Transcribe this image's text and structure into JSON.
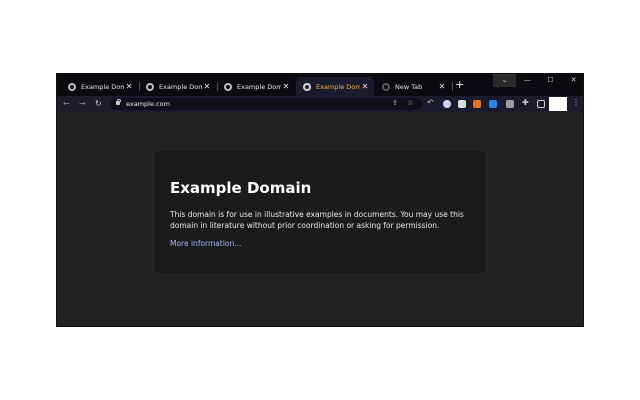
{
  "tabs": [
    {
      "label": "Example Domain",
      "close": "✕",
      "active": false
    },
    {
      "label": "Example Domain",
      "close": "✕",
      "active": false
    },
    {
      "label": "Example Domain",
      "close": "✕",
      "active": false
    },
    {
      "label": "Example Domain",
      "close": "✕",
      "active": true
    },
    {
      "label": "New Tab",
      "close": "✕",
      "active": false
    }
  ],
  "tab_new_button": "+",
  "window_controls": {
    "dropdown": "⌄",
    "minimize": "—",
    "maximize": "☐",
    "close": "✕"
  },
  "toolbar": {
    "back": "←",
    "forward": "→",
    "reload": "↻",
    "url": "example.com",
    "share_icon": "⇪",
    "bookmark_icon": "☆"
  },
  "extensions": [
    "reply-icon",
    "circle-extension-icon",
    "image-extension-icon",
    "fox-extension-icon",
    "blue-extension-icon",
    "gray-extension-icon",
    "puzzle-icon",
    "sidebar-icon"
  ],
  "colors": {
    "active_tab_text": "#f2b33d",
    "link": "#a9b4ff",
    "page_background": "#232323",
    "card_background": "#1b1b1b"
  },
  "page": {
    "heading": "Example Domain",
    "body": "This domain is for use in illustrative examples in documents. You may use this domain in literature without prior coordination or asking for permission.",
    "link": "More information..."
  }
}
